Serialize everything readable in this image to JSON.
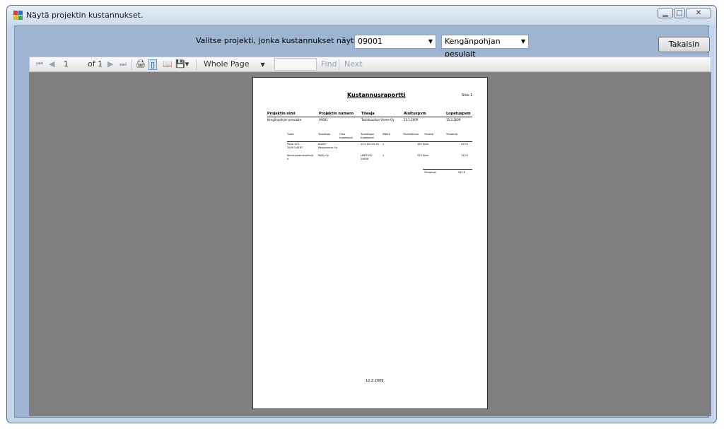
{
  "window": {
    "title": "Näytä projektin kustannukset."
  },
  "selection": {
    "prompt": "Valitse projekti, jonka kustannukset näytetään.",
    "project_number": "09001",
    "project_name": "Kengänpohjan pesulait",
    "back_label": "Takaisin"
  },
  "toolbar": {
    "page_current": "1",
    "page_of": "of 1",
    "zoom": "Whole Page",
    "find_label": "Find",
    "next_label": "Next"
  },
  "report": {
    "title": "Kustannusraportti",
    "page_label": "Sivu 1",
    "headers": [
      "Projektin nimi",
      "Projektin numero",
      "Tilaaja",
      "Aloituspvm",
      "Lopetuspvm"
    ],
    "values": [
      "Kengänpohjan pesulaite",
      "09001",
      "Tosiitkuudion Viome Oy",
      "15.1.2009",
      "15.2.2009"
    ],
    "item_headers": [
      "Tuote",
      "Toimittaja",
      "Oma tuotekoodi",
      "Toimittajan tuotekoodi",
      "Määrä",
      "Yksikköhinta",
      "Yksikkö",
      "Yhteensä"
    ],
    "items": [
      [
        "Pesia 223-1009.5.6187",
        "Aiseen Rasponanse Oy",
        "",
        "223-100-09-01",
        "1",
        "165 €/kpl",
        "",
        "223 €"
      ],
      [
        "Kuivauslaseukujenpp a",
        "Mylly Oy",
        "",
        "LMEP102-29838",
        "1",
        "374 €/kpl",
        "",
        "743 €"
      ]
    ],
    "total_label": "Yhteensä:",
    "total_value": "945 €",
    "footer_date": "12.2.2009"
  }
}
